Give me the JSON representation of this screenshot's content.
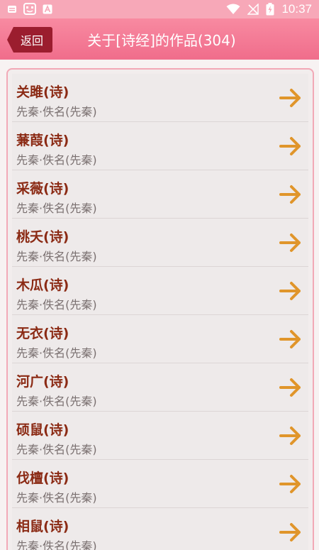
{
  "status_bar": {
    "time": "10:37",
    "icons_left": [
      "message-icon",
      "robot-app-icon",
      "a-letter-icon"
    ],
    "icons_right": [
      "wifi-icon",
      "no-signal-icon",
      "battery-charging-icon"
    ]
  },
  "header": {
    "back_label": "返回",
    "title": "关于[诗经]的作品(304)"
  },
  "colors": {
    "status_bar": "#f7a8b8",
    "header": "#f06d8b",
    "back_button": "#9b1d2e",
    "title_text": "#8b2a14",
    "arrow": "#e0952a"
  },
  "items": [
    {
      "title": "关雎(诗)",
      "subtitle": "先秦·佚名(先秦)"
    },
    {
      "title": "蒹葭(诗)",
      "subtitle": "先秦·佚名(先秦)"
    },
    {
      "title": "采薇(诗)",
      "subtitle": "先秦·佚名(先秦)"
    },
    {
      "title": "桃夭(诗)",
      "subtitle": "先秦·佚名(先秦)"
    },
    {
      "title": "木瓜(诗)",
      "subtitle": "先秦·佚名(先秦)"
    },
    {
      "title": "无衣(诗)",
      "subtitle": "先秦·佚名(先秦)"
    },
    {
      "title": "河广(诗)",
      "subtitle": "先秦·佚名(先秦)"
    },
    {
      "title": "硕鼠(诗)",
      "subtitle": "先秦·佚名(先秦)"
    },
    {
      "title": "伐檀(诗)",
      "subtitle": "先秦·佚名(先秦)"
    },
    {
      "title": "相鼠(诗)",
      "subtitle": "先秦·佚名(先秦)"
    }
  ]
}
